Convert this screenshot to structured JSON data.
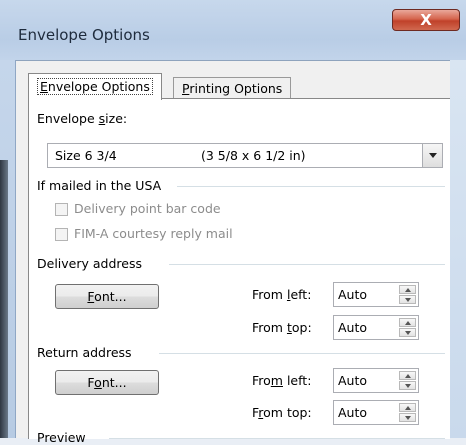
{
  "window": {
    "title": "Envelope Options",
    "close_glyph": "X"
  },
  "tabs": [
    {
      "pre": "",
      "key": "E",
      "post": "nvelope Options"
    },
    {
      "pre": "",
      "key": "P",
      "post": "rinting Options"
    }
  ],
  "envelope_size": {
    "label_pre": "Envelope ",
    "label_key": "s",
    "label_post": "ize:",
    "selected_name": "Size 6 3/4",
    "selected_dims": "(3 5/8 x 6 1/2 in)"
  },
  "usa": {
    "group_label": "If mailed in the USA",
    "barcode_label": "Delivery point bar code",
    "fim_label": "FIM-A courtesy reply mail"
  },
  "delivery": {
    "group_label": "Delivery address",
    "font_pre": "",
    "font_key": "F",
    "font_post": "ont...",
    "left_pre": "From ",
    "left_key": "l",
    "left_post": "eft:",
    "left_value": "Auto",
    "top_pre": "From ",
    "top_key": "t",
    "top_post": "op:",
    "top_value": "Auto"
  },
  "return": {
    "group_label": "Return address",
    "font_pre": "F",
    "font_key": "o",
    "font_post": "nt...",
    "left_pre": "Fro",
    "left_key": "m",
    "left_post": " left:",
    "left_value": "Auto",
    "top_pre": "F",
    "top_key": "r",
    "top_post": "om top:",
    "top_value": "Auto"
  },
  "preview": {
    "group_label": "Preview"
  }
}
